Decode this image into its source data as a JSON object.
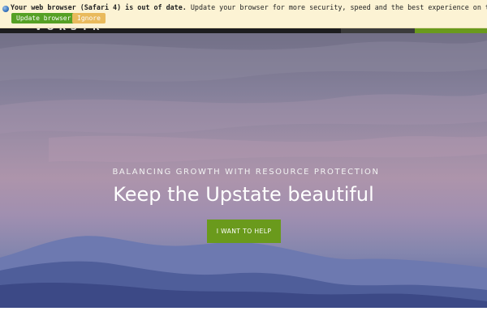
{
  "banner": {
    "headline": "Your web browser (Safari 4) is out of date.",
    "message": " Update your browser for more security, speed and the best experience on this site.",
    "update_label": "Update browser",
    "ignore_label": "Ignore",
    "icon": "info-icon"
  },
  "nav": {
    "logo_text": "~ V O R S T R"
  },
  "hero": {
    "tagline": "BALANCING GROWTH WITH RESOURCE PROTECTION",
    "headline": "Keep the Upstate beautiful",
    "cta_label": "I WANT TO HELP"
  },
  "colors": {
    "accent_green": "#6a9a1c",
    "banner_bg": "#fcf3d4",
    "update_button": "#55a024",
    "ignore_button": "#e9ba5c",
    "nav_dark": "#1c1c1e"
  }
}
